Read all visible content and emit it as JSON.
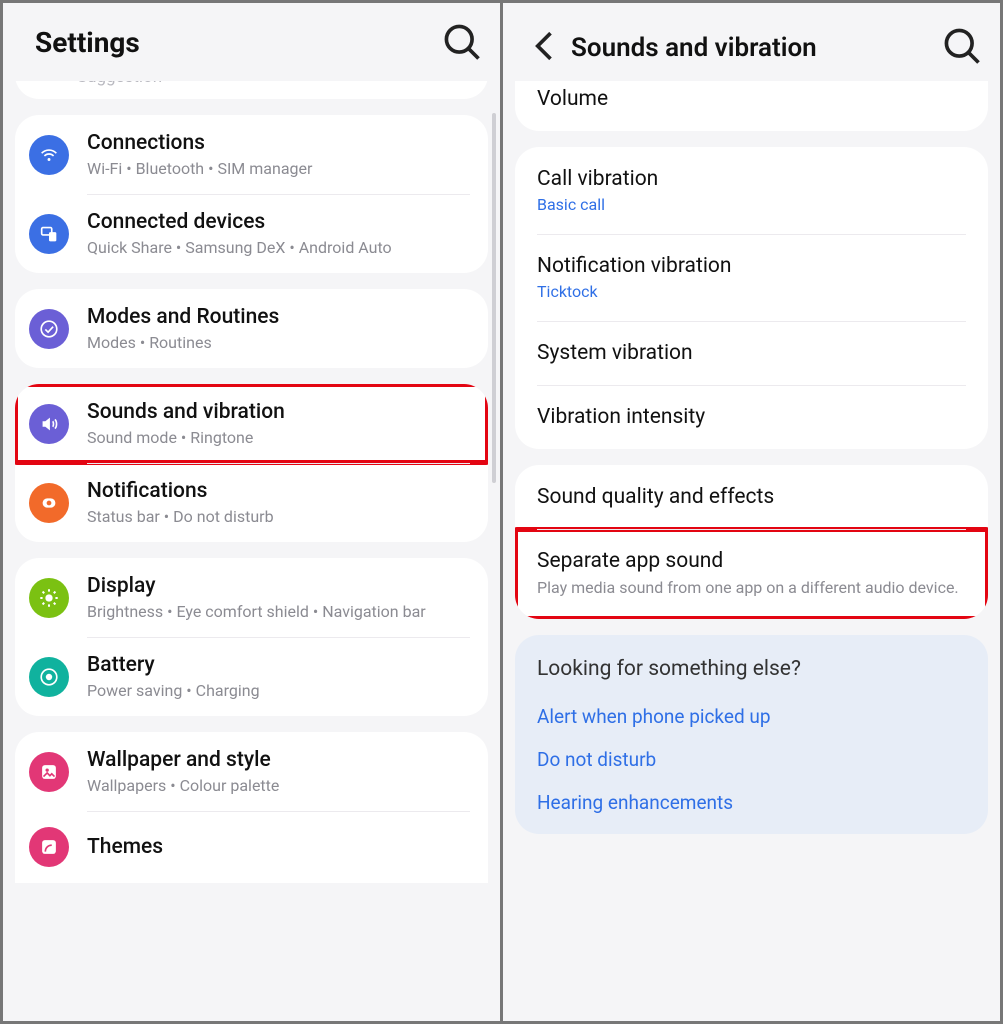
{
  "left": {
    "header_title": "Settings",
    "suggestion_stub": "Suggestion",
    "groups": [
      {
        "kind": "stub"
      },
      {
        "items": [
          {
            "id": "connections",
            "title": "Connections",
            "sub": "Wi-Fi  •  Bluetooth  •  SIM manager",
            "icon": "wifi",
            "color": "bg-blue"
          },
          {
            "id": "connected-devices",
            "title": "Connected devices",
            "sub": "Quick Share  •  Samsung DeX  •  Android Auto",
            "icon": "devices",
            "color": "bg-blue2"
          }
        ]
      },
      {
        "items": [
          {
            "id": "modes-routines",
            "title": "Modes and Routines",
            "sub": "Modes  •  Routines",
            "icon": "check-circle",
            "color": "bg-purple"
          }
        ]
      },
      {
        "items": [
          {
            "id": "sounds-vibration",
            "title": "Sounds and vibration",
            "sub": "Sound mode  •  Ringtone",
            "icon": "speaker",
            "color": "bg-purple2",
            "highlight": true
          },
          {
            "id": "notifications",
            "title": "Notifications",
            "sub": "Status bar  •  Do not disturb",
            "icon": "notif",
            "color": "bg-orange"
          }
        ]
      },
      {
        "items": [
          {
            "id": "display",
            "title": "Display",
            "sub": "Brightness  •  Eye comfort shield  •  Navigation bar",
            "icon": "sun",
            "color": "bg-green"
          },
          {
            "id": "battery",
            "title": "Battery",
            "sub": "Power saving  •  Charging",
            "icon": "battery",
            "color": "bg-teal"
          }
        ]
      },
      {
        "items": [
          {
            "id": "wallpaper",
            "title": "Wallpaper and style",
            "sub": "Wallpapers  •  Colour palette",
            "icon": "picture",
            "color": "bg-pink"
          },
          {
            "id": "themes",
            "title": "Themes",
            "sub": "",
            "icon": "palette",
            "color": "bg-pink2"
          }
        ],
        "partial_bottom": true
      }
    ]
  },
  "right": {
    "header_title": "Sounds and vibration",
    "groups": [
      {
        "items": [
          {
            "id": "volume",
            "title": "Volume"
          }
        ],
        "partial_top": true
      },
      {
        "items": [
          {
            "id": "call-vibration",
            "title": "Call vibration",
            "link": "Basic call"
          },
          {
            "id": "notification-vibration",
            "title": "Notification vibration",
            "link": "Ticktock"
          },
          {
            "id": "system-vibration",
            "title": "System vibration"
          },
          {
            "id": "vibration-intensity",
            "title": "Vibration intensity"
          }
        ]
      },
      {
        "items": [
          {
            "id": "sound-quality",
            "title": "Sound quality and effects"
          },
          {
            "id": "separate-app-sound",
            "title": "Separate app sound",
            "desc": "Play media sound from one app on a different audio device.",
            "highlight": true
          }
        ]
      }
    ],
    "looking": {
      "heading": "Looking for something else?",
      "links": [
        "Alert when phone picked up",
        "Do not disturb",
        "Hearing enhancements"
      ]
    }
  }
}
